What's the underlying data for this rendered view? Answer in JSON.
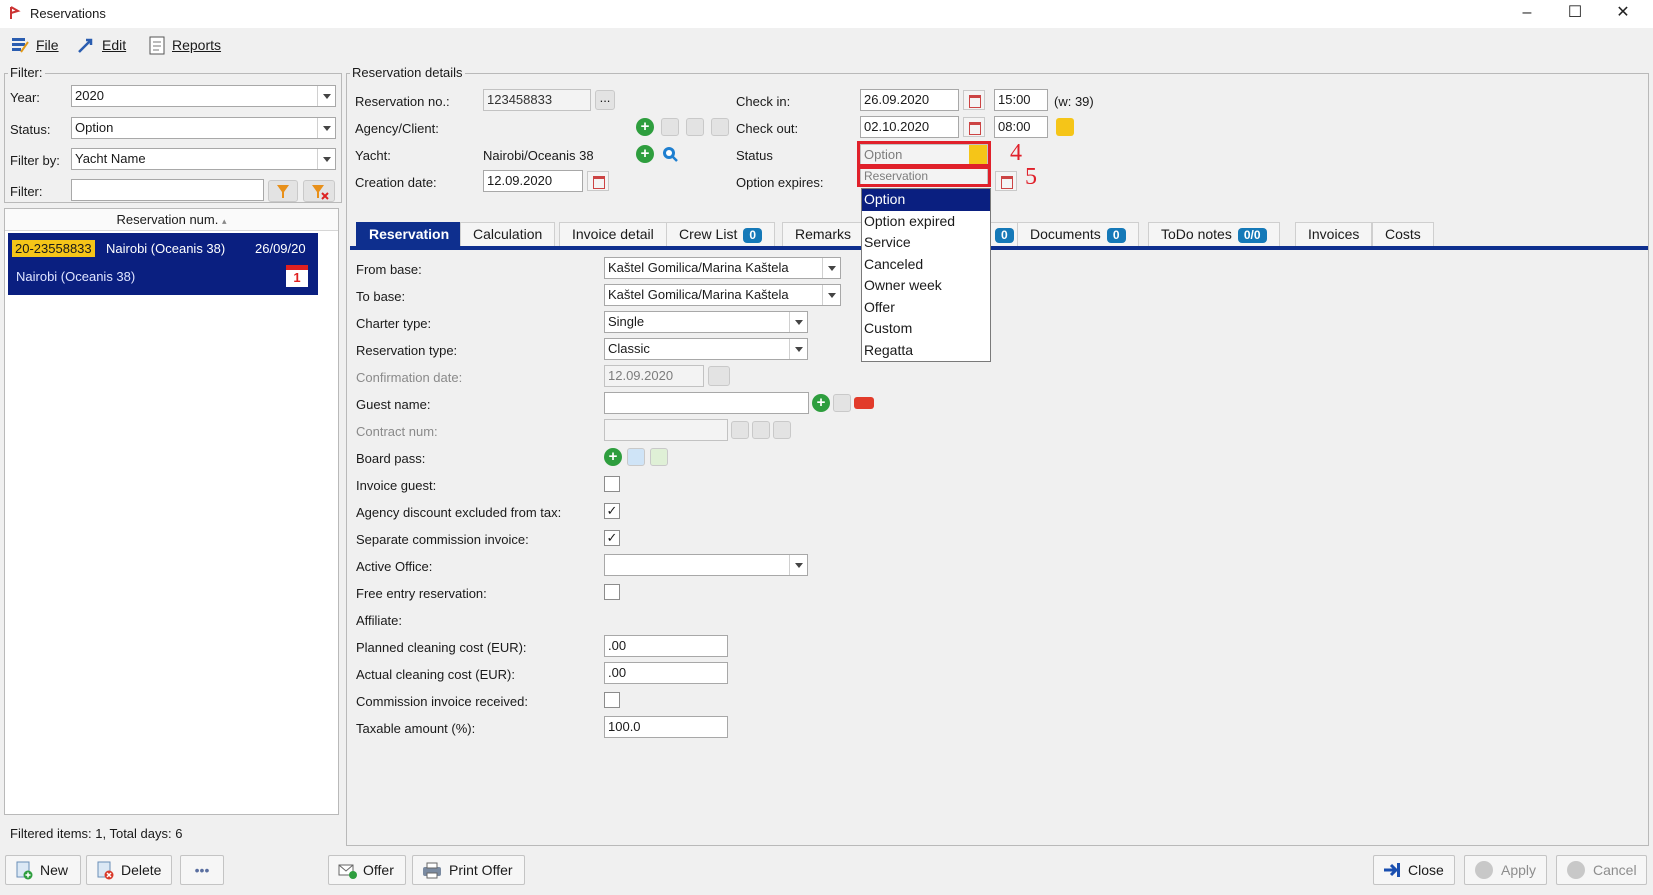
{
  "window": {
    "title": "Reservations"
  },
  "menu": {
    "file": "File",
    "edit": "Edit",
    "reports": "Reports"
  },
  "filter": {
    "group_label": "Filter:",
    "year_label": "Year:",
    "year_value": "2020",
    "status_label": "Status:",
    "status_value": "Option",
    "filterby_label": "Filter by:",
    "filterby_value": "Yacht Name",
    "filter_label": "Filter:",
    "filter_value": ""
  },
  "list": {
    "header": "Reservation num.",
    "rows": [
      {
        "id": "20-23558833",
        "yacht": "Nairobi (Oceanis 38)",
        "date": "26/09/20",
        "subline": "Nairobi (Oceanis 38)",
        "calendar_day": "1"
      }
    ],
    "footer": "Filtered items: 1,  Total days: 6"
  },
  "details": {
    "group_label": "Reservation details",
    "resno_label": "Reservation no.:",
    "resno_value": "123458833",
    "resno_btn": "...",
    "agency_label": "Agency/Client:",
    "yacht_label": "Yacht:",
    "yacht_value": "Nairobi/Oceanis 38",
    "creation_label": "Creation date:",
    "creation_value": "12.09.2020",
    "checkin_label": "Check in:",
    "checkin_date": "26.09.2020",
    "checkin_time": "15:00",
    "week": "(w: 39)",
    "checkout_label": "Check out:",
    "checkout_date": "02.10.2020",
    "checkout_time": "08:00",
    "status_label": "Status",
    "status_value": "Option",
    "option_expires_label": "Option expires:",
    "option_expires_value": "Reservation"
  },
  "status_dropdown": {
    "items": [
      "Option",
      "Option expired",
      "Service",
      "Canceled",
      "Owner week",
      "Offer",
      "Custom",
      "Regatta"
    ],
    "selected": "Option"
  },
  "annotations": {
    "a4": "4",
    "a5": "5"
  },
  "tabs": [
    {
      "label": "Reservation"
    },
    {
      "label": "Calculation"
    },
    {
      "label": "Invoice detail"
    },
    {
      "label": "Crew List",
      "badge": "0"
    },
    {
      "label": "Remarks"
    },
    {
      "label": "",
      "badge": "0"
    },
    {
      "label": "Documents",
      "badge": "0"
    },
    {
      "label": "ToDo notes",
      "badge": "0/0"
    },
    {
      "label": "Invoices"
    },
    {
      "label": "Costs"
    }
  ],
  "form": {
    "from_base_label": "From base:",
    "from_base_value": "Kaštel Gomilica/Marina Kaštela",
    "to_base_label": "To base:",
    "to_base_value": "Kaštel Gomilica/Marina Kaštela",
    "charter_type_label": "Charter type:",
    "charter_type_value": "Single",
    "reservation_type_label": "Reservation type:",
    "reservation_type_value": "Classic",
    "confirmation_date_label": "Confirmation date:",
    "confirmation_date_value": "12.09.2020",
    "guest_name_label": "Guest name:",
    "guest_name_value": "",
    "contract_num_label": "Contract num:",
    "contract_num_value": "",
    "board_pass_label": "Board pass:",
    "invoice_guest_label": "Invoice guest:",
    "invoice_guest_checked": false,
    "agency_discount_label": "Agency discount excluded from tax:",
    "agency_discount_checked": true,
    "separate_commission_label": "Separate commission invoice:",
    "separate_commission_checked": true,
    "active_office_label": "Active Office:",
    "active_office_value": "",
    "free_entry_label": "Free entry reservation:",
    "free_entry_checked": false,
    "affiliate_label": "Affiliate:",
    "planned_cleaning_label": "Planned cleaning cost (EUR):",
    "planned_cleaning_value": ".00",
    "actual_cleaning_label": "Actual cleaning cost (EUR):",
    "actual_cleaning_value": ".00",
    "commission_received_label": "Commission invoice received:",
    "commission_received_checked": false,
    "taxable_label": "Taxable amount (%):",
    "taxable_value": "100.0"
  },
  "buttons": {
    "new": "New",
    "delete": "Delete",
    "more": "•••",
    "offer": "Offer",
    "print_offer": "Print Offer",
    "close": "Close",
    "apply": "Apply",
    "cancel": "Cancel"
  },
  "colors": {
    "accent": "#0e2f8e",
    "badge": "#1579b8",
    "highlight": "#f5c518",
    "annotation": "#e0202a"
  }
}
